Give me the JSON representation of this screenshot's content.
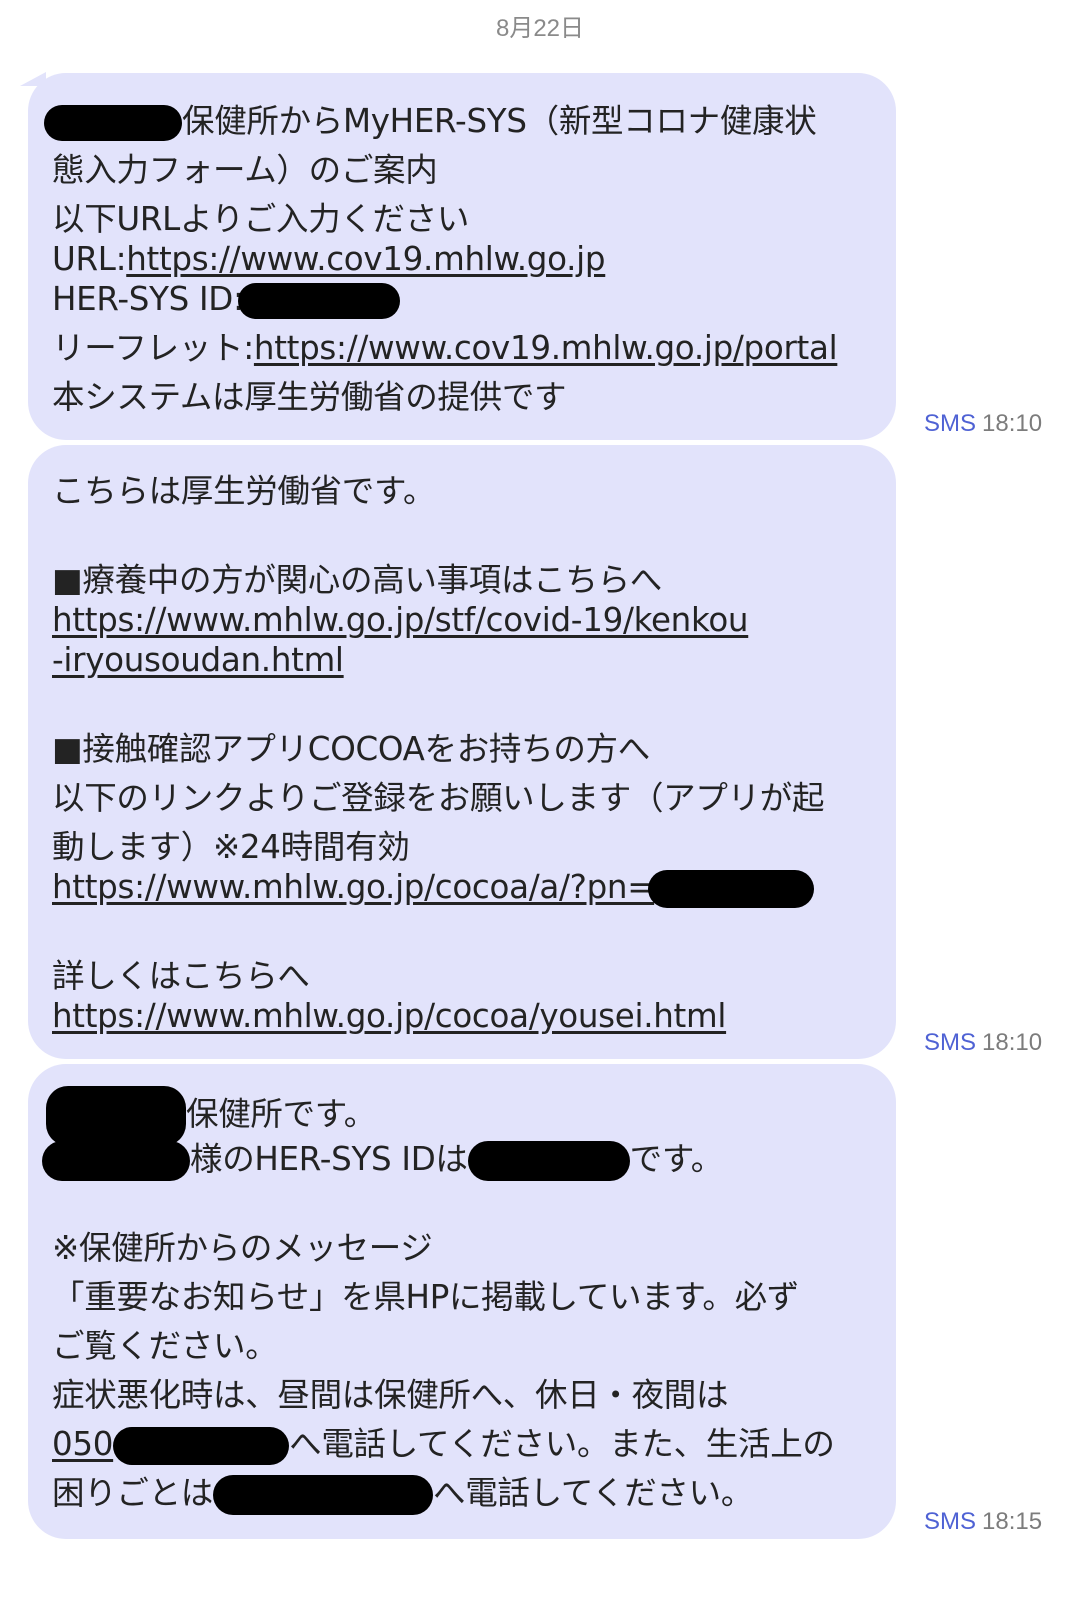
{
  "date_header": "8月22日",
  "messages": [
    {
      "type": "SMS",
      "time": "18:10",
      "lines": {
        "l1": "保健所からMyHER-SYS（新型コロナ健康状",
        "l2": "態入力フォーム）のご案内",
        "l3": "以下URLよりご入力ください",
        "l4_prefix": "URL:",
        "l4_link": "https://www.cov19.mhlw.go.jp",
        "l5_prefix": "HER-SYS ID:",
        "l6_prefix": "リーフレット:",
        "l6_link": "https://www.cov19.mhlw.go.jp/portal",
        "l7": "本システムは厚生労働省の提供です"
      }
    },
    {
      "type": "SMS",
      "time": "18:10",
      "lines": {
        "l1": "こちらは厚生労働省です。",
        "l2": "■療養中の方が関心の高い事項はこちらへ",
        "l3_link": "https://www.mhlw.go.jp/stf/covid-19/kenkou",
        "l4_link": "-iryousoudan.html",
        "l5": "■接触確認アプリCOCOAをお持ちの方へ",
        "l6": "以下のリンクよりご登録をお願いします（アプリが起",
        "l7": "動します）※24時間有効",
        "l8_link": "https://www.mhlw.go.jp/cocoa/a/?pn=",
        "l9": "詳しくはこちらへ",
        "l10_link": "https://www.mhlw.go.jp/cocoa/yousei.html"
      }
    },
    {
      "type": "SMS",
      "time": "18:15",
      "lines": {
        "l1": "保健所です。",
        "l2_mid": "様のHER-SYS IDは",
        "l2_end": "です。",
        "l3": "※保健所からのメッセージ",
        "l4": "「重要なお知らせ」を県HPに掲載しています。必ず",
        "l5": "ご覧ください。",
        "l6": "症状悪化時は、昼間は保健所へ、休日・夜間は",
        "l7_link": "050",
        "l7_end": "へ電話してください。また、生活上の",
        "l8_start": "困りごとは",
        "l8_end": "へ電話してください。"
      }
    }
  ]
}
